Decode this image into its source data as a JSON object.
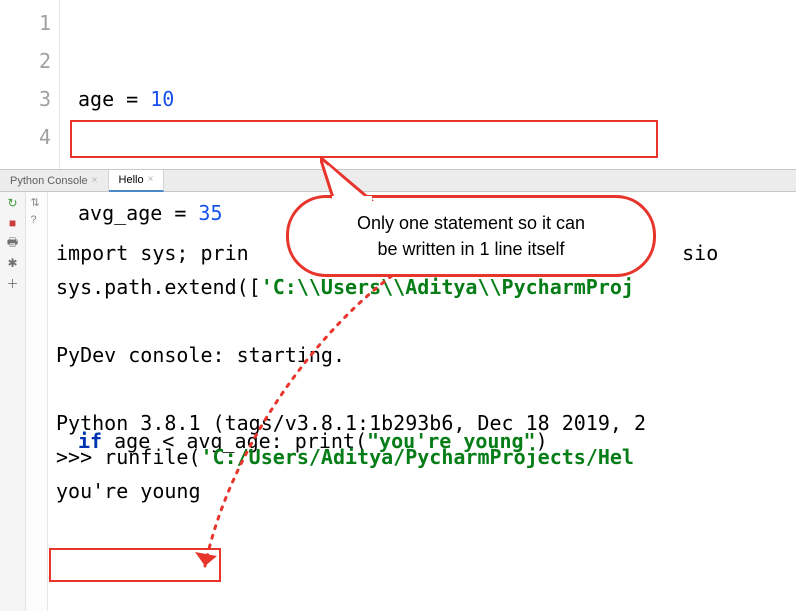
{
  "editor": {
    "lines": {
      "l1": "1",
      "l2": "2",
      "l3": "3",
      "l4": "4"
    },
    "code": {
      "assign1_var": "age",
      "assign1_eq": " = ",
      "assign1_val": "10",
      "assign2_var": "avg_age",
      "assign2_eq": " = ",
      "assign2_val": "35",
      "kw_if": "if",
      "cond": " age < avg_age: ",
      "fn_print": "print",
      "open": "(",
      "str": "\"you're young\"",
      "close": ")"
    }
  },
  "tabs": {
    "t1": "Python Console",
    "t2": "Hello"
  },
  "console": {
    "import_prefix": "import sys; prin",
    "import_suffix": "sio",
    "syspath_prefix": "sys.path.extend([",
    "syspath_str": "'C:\\\\Users\\\\Aditya\\\\PycharmProj",
    "pydev": "PyDev console: starting.",
    "pyver": "Python 3.8.1 (tags/v3.8.1:1b293b6, Dec 18 2019, 2",
    "prompt": ">>> ",
    "runfile_fn": "runfile(",
    "runfile_str": "'C:/Users/Aditya/PycharmProjects/Hel",
    "output": "you're young"
  },
  "callout": {
    "line1": "Only one statement so it can",
    "line2": "be written in 1 line itself"
  },
  "icons": {
    "rerun": "rerun-icon",
    "stop": "stop-icon",
    "print": "print-icon",
    "settings": "settings-icon",
    "add": "add-icon",
    "help": "help-icon"
  }
}
